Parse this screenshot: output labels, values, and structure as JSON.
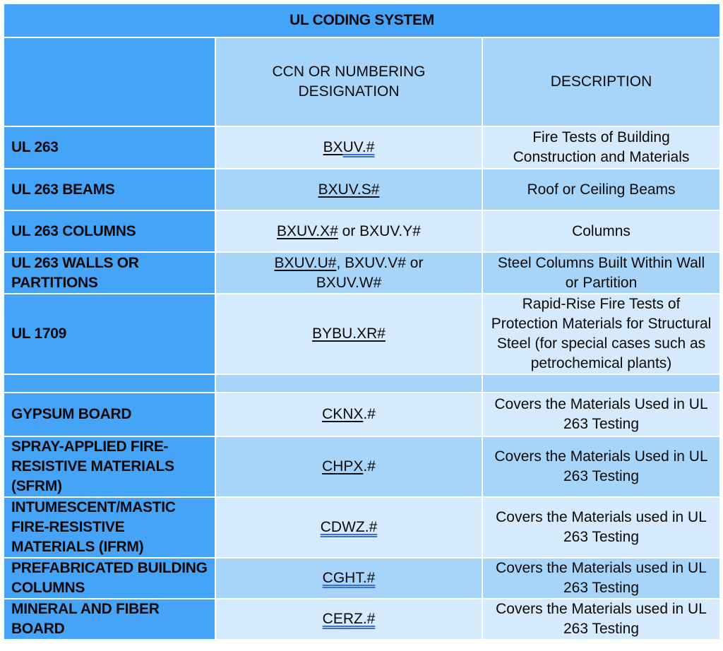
{
  "table": {
    "title": "UL CODING SYSTEM",
    "headers": {
      "label": "",
      "code": "CCN OR NUMBERING DESIGNATION",
      "description": "DESCRIPTION"
    },
    "rows": [
      {
        "label": "UL 263",
        "code_a": "BX",
        "code_b": "UV.#",
        "code_c": "",
        "description": "Fire Tests of Building Construction and Materials"
      },
      {
        "label": "UL 263 BEAMS",
        "code_a": "BXUV.S#",
        "code_b": "",
        "code_c": "",
        "description": "Roof or Ceiling Beams"
      },
      {
        "label": "UL 263 COLUMNS",
        "code_a": "BXUV.X#",
        "code_b": "",
        "code_c": " or BXUV.Y#",
        "description": "Columns"
      },
      {
        "label": "UL 263 WALLS OR PARTITIONS",
        "code_a": "BXUV.U#",
        "code_b": "",
        "code_c": ", BXUV.V# or BXUV.W#",
        "description": "Steel Columns Built Within Wall or Partition"
      },
      {
        "label": "UL 1709",
        "code_a": "BYBU.XR#",
        "code_b": "",
        "code_c": "",
        "description": "Rapid-Rise Fire Tests of Protection Materials for Structural Steel (for special cases such as petrochemical plants)"
      },
      {
        "label": "",
        "code_a": "",
        "code_b": "",
        "code_c": "",
        "description": ""
      },
      {
        "label": "GYPSUM BOARD",
        "code_a": "CKNX",
        "code_b": "",
        "code_c": ".#",
        "description": "Covers the Materials Used in UL 263 Testing"
      },
      {
        "label": "SPRAY-APPLIED FIRE-RESISTIVE MATERIALS (SFRM)",
        "code_a": "CHPX",
        "code_b": "",
        "code_c": ".#",
        "description": "Covers the Materials Used in UL 263 Testing"
      },
      {
        "label": "INTUMESCENT/MASTIC FIRE-RESISTIVE MATERIALS (IFRM)",
        "code_a": "",
        "code_b": "CDWZ.#",
        "code_c": "",
        "description": "Covers the Materials used in UL 263 Testing"
      },
      {
        "label": "PREFABRICATED BUILDING COLUMNS",
        "code_a": "",
        "code_b": "CGHT.#",
        "code_c": "",
        "description": "Covers the Materials used in UL 263 Testing"
      },
      {
        "label": "MINERAL AND FIBER BOARD",
        "code_a": "",
        "code_b": "CERZ.#",
        "code_c": "",
        "description": "Covers the Materials used in UL 263 Testing"
      }
    ],
    "colors": {
      "dark_blue": "#45a3f8",
      "mid_blue": "#a7d5fa",
      "light_blue": "#d5eafc"
    }
  }
}
